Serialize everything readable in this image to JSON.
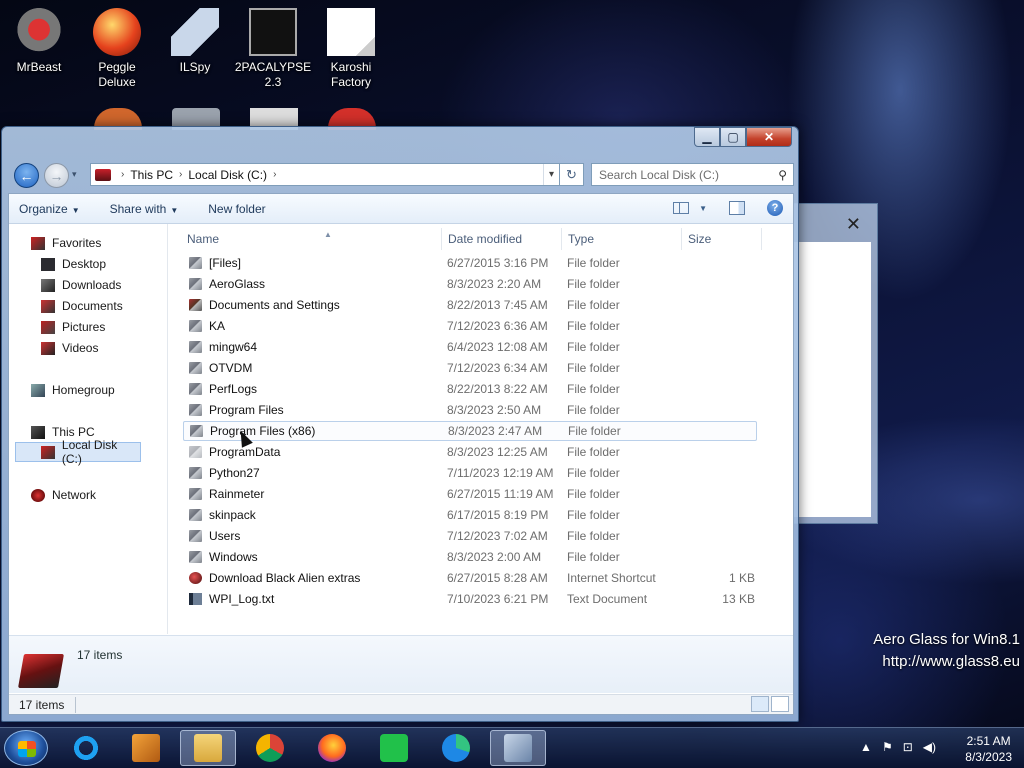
{
  "desktop": {
    "icons": [
      {
        "label": "MrBeast"
      },
      {
        "label": "Peggle Deluxe"
      },
      {
        "label": "ILSpy"
      },
      {
        "label": "2PACALYPSE 2.3"
      },
      {
        "label": "Karoshi Factory"
      }
    ],
    "watermark": {
      "line1": "Aero Glass for Win8.1",
      "line2": "http://www.glass8.eu"
    }
  },
  "explorer": {
    "address": {
      "crumbs": [
        "This PC",
        "Local Disk (C:)"
      ]
    },
    "search": {
      "placeholder": "Search Local Disk (C:)"
    },
    "toolbar": {
      "organize": "Organize",
      "share_with": "Share with",
      "new_folder": "New folder"
    },
    "nav": {
      "favorites": "Favorites",
      "desktop": "Desktop",
      "downloads": "Downloads",
      "documents": "Documents",
      "pictures": "Pictures",
      "videos": "Videos",
      "homegroup": "Homegroup",
      "this_pc": "This PC",
      "local_disk": "Local Disk (C:)",
      "network": "Network"
    },
    "columns": {
      "name": "Name",
      "date": "Date modified",
      "type": "Type",
      "size": "Size"
    },
    "files": [
      {
        "name": "[Files]",
        "date": "6/27/2015 3:16 PM",
        "type": "File folder",
        "size": "",
        "icon": "folder-icon"
      },
      {
        "name": "AeroGlass",
        "date": "8/3/2023 2:20 AM",
        "type": "File folder",
        "size": "",
        "icon": "folder-icon"
      },
      {
        "name": "Documents and Settings",
        "date": "8/22/2013 7:45 AM",
        "type": "File folder",
        "size": "",
        "icon": "shortcut-folder-icon"
      },
      {
        "name": "KA",
        "date": "7/12/2023 6:36 AM",
        "type": "File folder",
        "size": "",
        "icon": "folder-icon"
      },
      {
        "name": "mingw64",
        "date": "6/4/2023 12:08 AM",
        "type": "File folder",
        "size": "",
        "icon": "folder-icon"
      },
      {
        "name": "OTVDM",
        "date": "7/12/2023 6:34 AM",
        "type": "File folder",
        "size": "",
        "icon": "folder-icon"
      },
      {
        "name": "PerfLogs",
        "date": "8/22/2013 8:22 AM",
        "type": "File folder",
        "size": "",
        "icon": "folder-icon"
      },
      {
        "name": "Program Files",
        "date": "8/3/2023 2:50 AM",
        "type": "File folder",
        "size": "",
        "icon": "folder-icon"
      },
      {
        "name": "Program Files (x86)",
        "date": "8/3/2023 2:47 AM",
        "type": "File folder",
        "size": "",
        "icon": "folder-icon"
      },
      {
        "name": "ProgramData",
        "date": "8/3/2023 12:25 AM",
        "type": "File folder",
        "size": "",
        "icon": "hidden-folder-icon"
      },
      {
        "name": "Python27",
        "date": "7/11/2023 12:19 AM",
        "type": "File folder",
        "size": "",
        "icon": "folder-icon"
      },
      {
        "name": "Rainmeter",
        "date": "6/27/2015 11:19 AM",
        "type": "File folder",
        "size": "",
        "icon": "folder-icon"
      },
      {
        "name": "skinpack",
        "date": "6/17/2015 8:19 PM",
        "type": "File folder",
        "size": "",
        "icon": "folder-icon"
      },
      {
        "name": "Users",
        "date": "7/12/2023 7:02 AM",
        "type": "File folder",
        "size": "",
        "icon": "folder-icon"
      },
      {
        "name": "Windows",
        "date": "8/3/2023 2:00 AM",
        "type": "File folder",
        "size": "",
        "icon": "folder-icon"
      },
      {
        "name": "Download Black Alien extras",
        "date": "6/27/2015 8:28 AM",
        "type": "Internet Shortcut",
        "size": "1 KB",
        "icon": "internet-shortcut-icon"
      },
      {
        "name": "WPI_Log.txt",
        "date": "7/10/2023 6:21 PM",
        "type": "Text Document",
        "size": "13 KB",
        "icon": "text-document-icon"
      }
    ],
    "details": {
      "count": "17 items"
    },
    "status": {
      "count": "17 items"
    }
  },
  "taskbar": {
    "clock": {
      "time": "2:51 AM",
      "date": "8/3/2023"
    }
  }
}
